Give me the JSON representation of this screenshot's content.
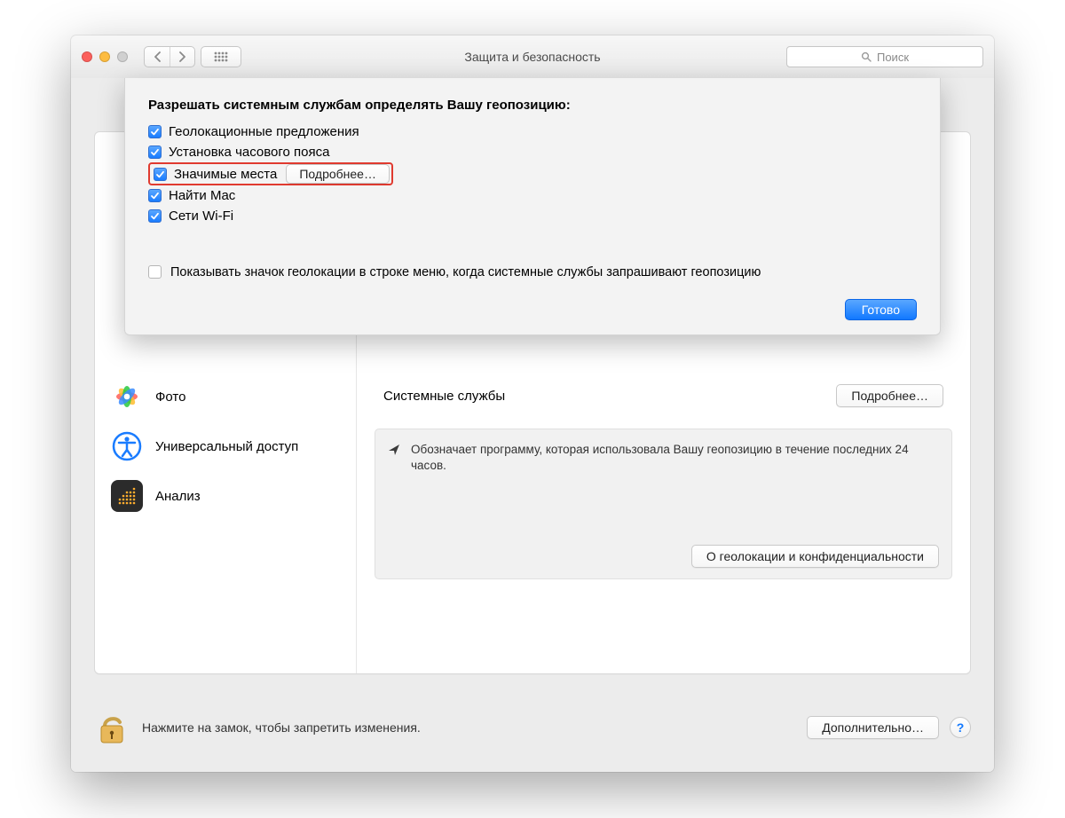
{
  "window": {
    "title": "Защита и безопасность",
    "search_placeholder": "Поиск"
  },
  "sheet": {
    "heading": "Разрешать системным службам определять Вашу геопозицию:",
    "items": [
      {
        "label": "Геолокационные предложения",
        "checked": true,
        "details": false
      },
      {
        "label": "Установка часового пояса",
        "checked": true,
        "details": false
      },
      {
        "label": "Значимые места",
        "checked": true,
        "details": true,
        "highlight": true
      },
      {
        "label": "Найти Mac",
        "checked": true,
        "details": false
      },
      {
        "label": "Сети Wi-Fi",
        "checked": true,
        "details": false
      }
    ],
    "details_label": "Подробнее…",
    "menu_icon_checkbox_label": "Показывать значок геолокации в строке меню, когда системные службы запрашивают геопозицию",
    "done_label": "Готово"
  },
  "sidebar": {
    "photos_label": "Фото",
    "accessibility_label": "Универсальный доступ",
    "analytics_label": "Анализ"
  },
  "content": {
    "system_services_label": "Системные службы",
    "details_label": "Подробнее…",
    "note_text": "Обозначает программу, которая использовала Вашу геопозицию в течение последних 24 часов.",
    "about_label": "О геолокации и конфиденциальности"
  },
  "footer": {
    "lock_text": "Нажмите на замок, чтобы запретить изменения.",
    "advanced_label": "Дополнительно…"
  }
}
